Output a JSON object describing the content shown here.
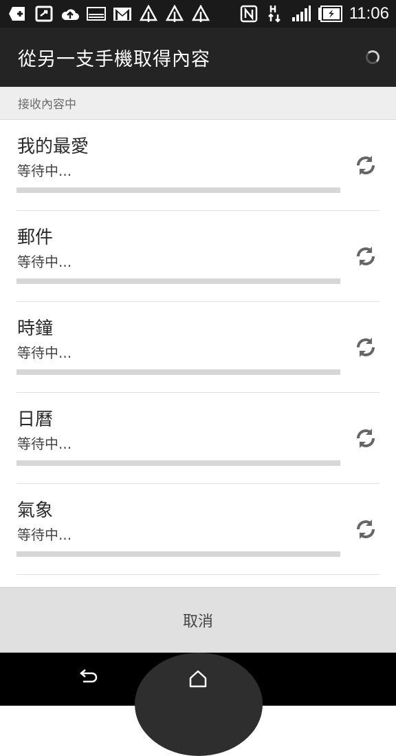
{
  "status_bar": {
    "icons": [
      "add-box-icon",
      "screen-rotation-icon",
      "cloud-upload-icon",
      "gallery-icon",
      "gmail-icon",
      "tree-icon",
      "tree-icon",
      "tree-icon",
      "nfc-icon",
      "signal-hplus-icon",
      "cell-signal-icon",
      "battery-charging-icon"
    ],
    "time": "11:06"
  },
  "action_bar": {
    "title": "從另一支手機取得內容"
  },
  "section_header": "接收內容中",
  "items": [
    {
      "title": "我的最愛",
      "status": "等待中...",
      "progress": 0
    },
    {
      "title": "郵件",
      "status": "等待中...",
      "progress": 0
    },
    {
      "title": "時鐘",
      "status": "等待中...",
      "progress": 0
    },
    {
      "title": "日曆",
      "status": "等待中...",
      "progress": 0
    },
    {
      "title": "氣象",
      "status": "等待中...",
      "progress": 0
    }
  ],
  "cancel_label": "取消",
  "nav": {
    "back_icon": "back-icon",
    "home_icon": "home-icon"
  }
}
